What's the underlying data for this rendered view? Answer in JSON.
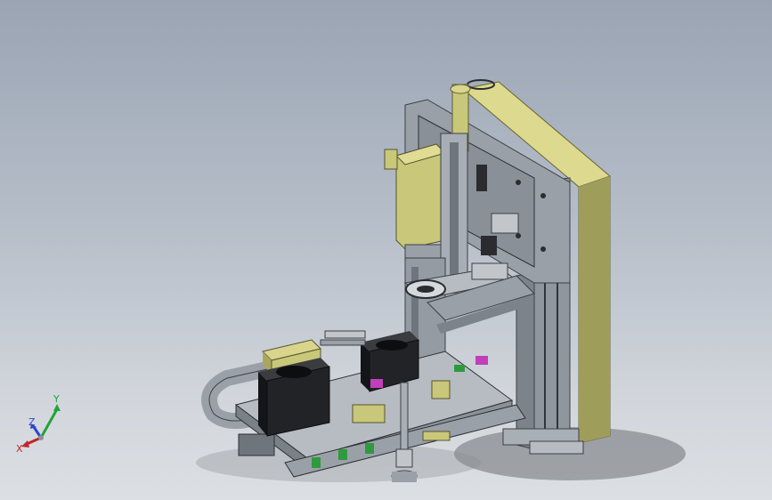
{
  "viewport": {
    "background_top": "#9aa4b3",
    "background_bottom": "#dcdfe3"
  },
  "model": {
    "accent_color": "#c9c77a",
    "metal_color": "#8f969e",
    "dark_color": "#1e1f22",
    "marker_color": "#c13fb8"
  },
  "triad": {
    "x_label": "X",
    "y_label": "Y",
    "z_label": "Z",
    "x_color": "#c0262d",
    "y_color": "#21a33a",
    "z_color": "#2a48c8"
  }
}
